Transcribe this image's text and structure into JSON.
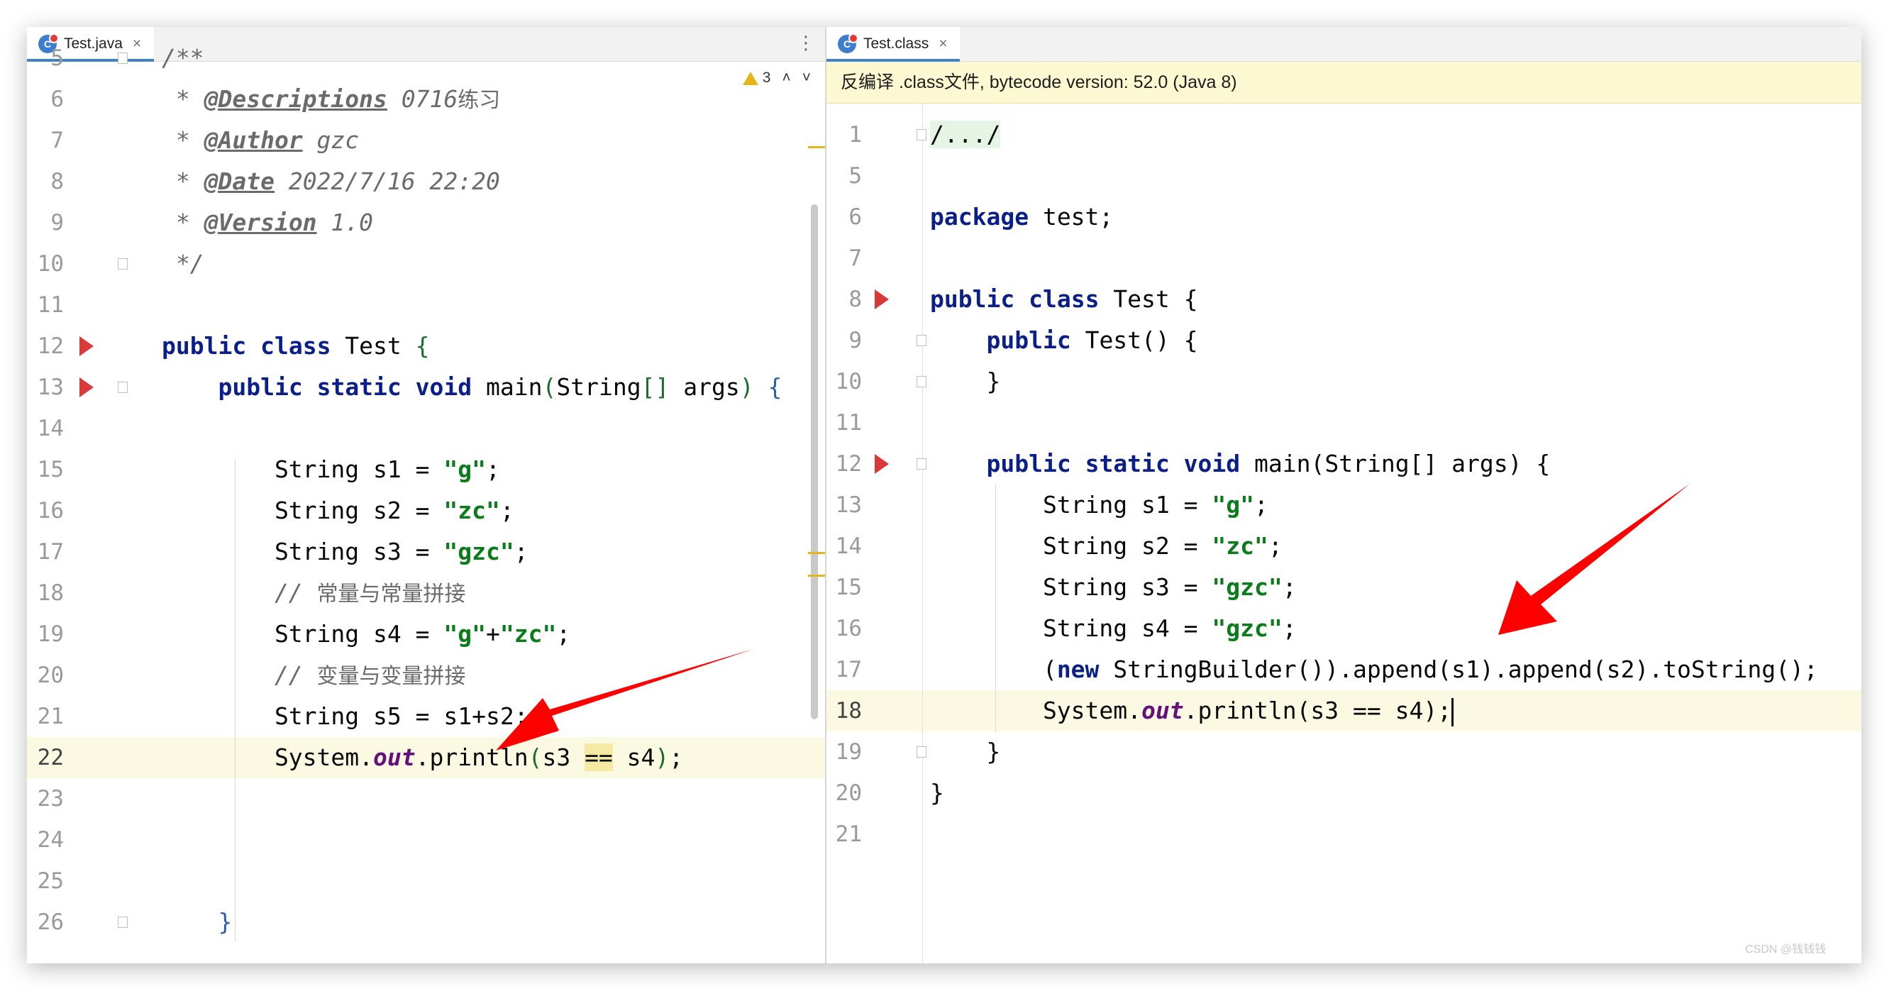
{
  "left_editor": {
    "tab": {
      "icon": "class-file-icon",
      "icon_glyph": "C",
      "label": "Test.java",
      "close": "×"
    },
    "menu_icon": "⋮",
    "inspection": {
      "icon": "warning-icon",
      "count": "3",
      "up": "˄",
      "down": "˅"
    },
    "lines": [
      {
        "n": "5",
        "text": "/**"
      },
      {
        "n": "6",
        "text": " * @Descriptions 0716练习"
      },
      {
        "n": "7",
        "text": " * @Author gzc"
      },
      {
        "n": "8",
        "text": " * @Date 2022/7/16 22:20"
      },
      {
        "n": "9",
        "text": " * @Version 1.0"
      },
      {
        "n": "10",
        "text": " */"
      },
      {
        "n": "11",
        "text": ""
      },
      {
        "n": "12",
        "text": "public class Test {"
      },
      {
        "n": "13",
        "text": "    public static void main(String[] args) {"
      },
      {
        "n": "14",
        "text": ""
      },
      {
        "n": "15",
        "text": "        String s1 = \"g\";"
      },
      {
        "n": "16",
        "text": "        String s2 = \"zc\";"
      },
      {
        "n": "17",
        "text": "        String s3 = \"gzc\";"
      },
      {
        "n": "18",
        "text": "        // 常量与常量拼接"
      },
      {
        "n": "19",
        "text": "        String s4 = \"g\"+\"zc\";"
      },
      {
        "n": "20",
        "text": "        // 变量与变量拼接"
      },
      {
        "n": "21",
        "text": "        String s5 = s1+s2;"
      },
      {
        "n": "22",
        "text": "        System.out.println(s3 == s4);"
      },
      {
        "n": "23",
        "text": ""
      },
      {
        "n": "24",
        "text": ""
      },
      {
        "n": "25",
        "text": ""
      },
      {
        "n": "26",
        "text": "    }"
      }
    ],
    "current_line": "22"
  },
  "right_editor": {
    "tab": {
      "icon": "class-file-icon",
      "icon_glyph": "C",
      "label": "Test.class",
      "close": "×"
    },
    "banner": "反编译 .class文件, bytecode version: 52.0 (Java 8)",
    "lines": [
      {
        "n": "1",
        "text": "/.../"
      },
      {
        "n": "5",
        "text": ""
      },
      {
        "n": "6",
        "text": "package test;"
      },
      {
        "n": "7",
        "text": ""
      },
      {
        "n": "8",
        "text": "public class Test {"
      },
      {
        "n": "9",
        "text": "    public Test() {"
      },
      {
        "n": "10",
        "text": "    }"
      },
      {
        "n": "11",
        "text": ""
      },
      {
        "n": "12",
        "text": "    public static void main(String[] args) {"
      },
      {
        "n": "13",
        "text": "        String s1 = \"g\";"
      },
      {
        "n": "14",
        "text": "        String s2 = \"zc\";"
      },
      {
        "n": "15",
        "text": "        String s3 = \"gzc\";"
      },
      {
        "n": "16",
        "text": "        String s4 = \"gzc\";"
      },
      {
        "n": "17",
        "text": "        (new StringBuilder()).append(s1).append(s2).toString();"
      },
      {
        "n": "18",
        "text": "        System.out.println(s3 == s4);"
      },
      {
        "n": "19",
        "text": "    }"
      },
      {
        "n": "20",
        "text": "}"
      },
      {
        "n": "21",
        "text": ""
      }
    ],
    "current_line": "18"
  },
  "watermark": "CSDN @钱钱钱",
  "colors": {
    "keyword": "#0a1f8a",
    "string": "#0a7d1a",
    "comment": "#6b6b6b",
    "static_field": "#660e7a",
    "current_line": "#fcf9e3",
    "arrow": "#ff0000",
    "tab_underline": "#4083c9"
  }
}
